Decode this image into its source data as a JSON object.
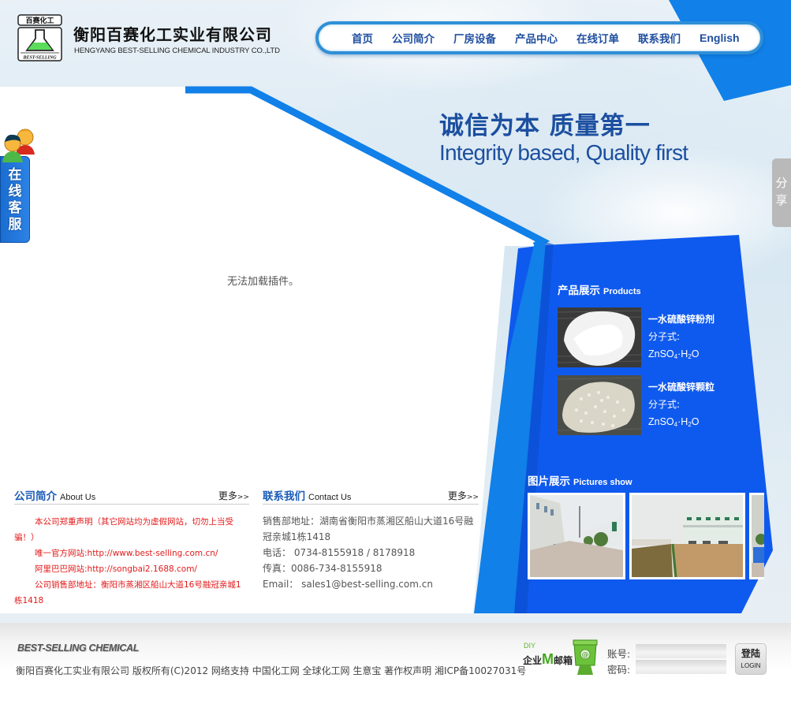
{
  "header": {
    "logo_top_text": "百赛化工",
    "logo_bottom_text": "BEST-SELLING",
    "company_name_cn": "衡阳百赛化工实业有限公司",
    "company_name_en": "HENGYANG BEST-SELLING CHEMICAL INDUSTRY CO.,LTD"
  },
  "nav": {
    "items": [
      {
        "label": "首页"
      },
      {
        "label": "公司简介"
      },
      {
        "label": "厂房设备"
      },
      {
        "label": "产品中心"
      },
      {
        "label": "在线订单"
      },
      {
        "label": "联系我们"
      },
      {
        "label": "English"
      }
    ]
  },
  "banner": {
    "slogan_cn": "诚信为本  质量第一",
    "slogan_en": "Integrity based, Quality first",
    "plugin_message": "无法加载插件。"
  },
  "side": {
    "online_service": "在线客服",
    "share": "分享"
  },
  "products": {
    "title_cn": "产品展示",
    "title_en": "Products",
    "items": [
      {
        "name": "一水硫酸锌粉剂",
        "formula_label": "分子式:",
        "formula": "ZnSO4·H2O",
        "image": "white powder"
      },
      {
        "name": "一水硫酸锌颗粒",
        "formula_label": "分子式:",
        "formula": "ZnSO4·H2O",
        "image": "white granules"
      }
    ]
  },
  "pictures": {
    "title_cn": "图片展示",
    "title_en": "Pictures show",
    "items": [
      {
        "alt": "factory street"
      },
      {
        "alt": "office building and yard"
      },
      {
        "alt": "factory street partial"
      }
    ]
  },
  "about": {
    "title_cn": "公司简介",
    "title_en": "About Us",
    "more": "更多",
    "more_arrows": ">>",
    "lines": [
      "本公司郑重声明（其它网站均为虚假网站，切勿上当受骗！）",
      "唯一官方网站:http://www.best-selling.com.cn/",
      "阿里巴巴网站:http://songbai2.1688.com/",
      "公司销售部地址：衡阳市蒸湘区船山大道16号融冠亲城1栋1418"
    ]
  },
  "contact": {
    "title_cn": "联系我们",
    "title_en": "Contact Us",
    "more": "更多",
    "more_arrows": ">>",
    "lines": [
      "销售部地址：湖南省衡阳市蒸湘区船山大道16号融冠亲城1栋1418",
      "电话：  0734-8155918 / 8178918",
      "传真：0086-734-8155918",
      "Email：  sales1@best-selling.com.cn"
    ]
  },
  "footer": {
    "brand": "BEST-SELLING CHEMICAL",
    "copyright": "衡阳百赛化工实业有限公司 版权所有(C)2012 网络支持 中国化工网 全球化工网 生意宝 著作权声明 湘ICP备10027031号",
    "mail": {
      "diy": "DIY",
      "title_pre": "企业",
      "title_m": "M",
      "title_post": "邮箱",
      "account_label": "账号:",
      "password_label": "密码:",
      "account_value": "",
      "password_value": "",
      "login_cn": "登陆",
      "login_en": "LOGIN"
    }
  },
  "colors": {
    "brand_blue": "#0f5aee",
    "accent_blue": "#1180e8",
    "nav_text": "#1f4f9f",
    "notice_red": "#e31a1a"
  }
}
